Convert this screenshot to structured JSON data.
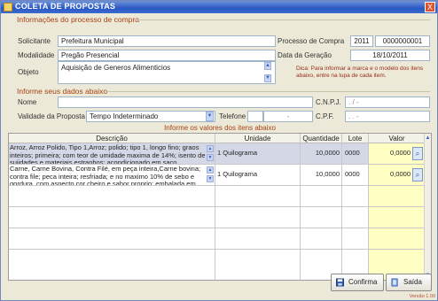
{
  "window": {
    "title": "COLETA DE PROPOSTAS",
    "close_label": "X"
  },
  "processo": {
    "section_title": "Informações do processo de compra",
    "solicitante_label": "Solicitante",
    "solicitante": "Prefeitura Municipal",
    "modalidade_label": "Modalidade",
    "modalidade": "Pregão Presencial",
    "objeto_label": "Objeto",
    "objeto": "Aquisição de Generos Alimenticios",
    "processo_label": "Processo de Compra",
    "processo_ano": "2011",
    "processo_num": "0000000001",
    "data_label": "Data da Geração",
    "data": "18/10/2011",
    "dica": "Dica: Para informar a marca e o modelo dos itens abaixo, entre na lupa de cada item."
  },
  "dados": {
    "section_title": "Informe seus dados abaixo",
    "nome_label": "Nome",
    "nome": "",
    "cnpj_label": "C.N.P.J.",
    "cnpj": ". / -",
    "validade_label": "Validade da Proposta",
    "validade": "Tempo Indeterminado",
    "telefone_label": "Telefone",
    "telefone_sep": "-",
    "cpf_label": "C.P.F.",
    "cpf": ". . -"
  },
  "itens": {
    "caption": "Informe os valores dos itens abaixo",
    "headers": {
      "descricao": "Descrição",
      "unidade": "Unidade",
      "quantidade": "Quantidade",
      "lote": "Lote",
      "valor": "Valor"
    },
    "rows": [
      {
        "descricao": "Arroz, Arroz Polido, Tipo 1,Arroz; polido; tipo 1, longo fino; graos inteiros; primeira; com teor de umidade maxima de 14%; isento de sujidades e materiais estranhos; acondicionado em saco",
        "unidade": "1 Quilograma",
        "quantidade": "10,0000",
        "lote": "0000",
        "valor": "0,0000"
      },
      {
        "descricao": "Carne, Carne Bovina, Contra Filé, em peça inteira,Carne bovina; contra file; peca inteira; resfriada; e no maximo 10% de sebo e gordura, com aspecto cor cheiro e sabor proprio; embalada em",
        "unidade": "1 Quilograma",
        "quantidade": "10,0000",
        "lote": "0000",
        "valor": "0,0000"
      }
    ]
  },
  "buttons": {
    "confirma": "Confirma",
    "saida": "Saída"
  },
  "version": "Versão 1.00"
}
